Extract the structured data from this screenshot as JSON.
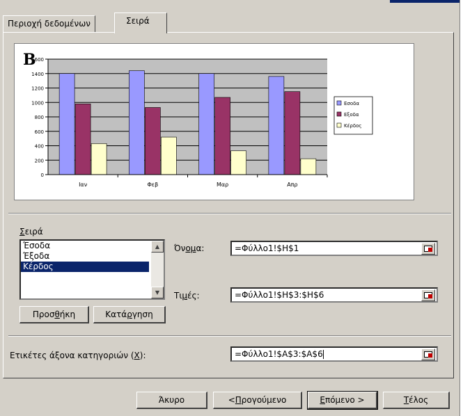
{
  "tabs": [
    "Περιοχή δεδομένων",
    "Σειρά"
  ],
  "preview_label": "B",
  "chart_data": {
    "type": "bar",
    "categories": [
      "Ιαν",
      "Φεβ",
      "Μαρ",
      "Απρ"
    ],
    "series": [
      {
        "name": "Εσοδα",
        "values": [
          1400,
          1440,
          1400,
          1360
        ],
        "color": "#9999ff"
      },
      {
        "name": "Εξοδα",
        "values": [
          980,
          930,
          1070,
          1150
        ],
        "color": "#993366"
      },
      {
        "name": "Κέρδος",
        "values": [
          430,
          520,
          330,
          220
        ],
        "color": "#ffffcc"
      }
    ],
    "yticks": [
      0,
      200,
      400,
      600,
      800,
      1000,
      1200,
      1400,
      1600
    ],
    "ylim": [
      0,
      1600
    ],
    "grid": true,
    "legend": "right",
    "plot_background": "#c0c0c0"
  },
  "series_section": {
    "title_pre": "",
    "title_u": "Σ",
    "title_post": "ειρά",
    "items": [
      "Έσοδα",
      "Έξοδα",
      "Κέρδος"
    ],
    "selected": "Κέρδος",
    "add_pre": "Προσ",
    "add_u": "θ",
    "add_post": "ήκη",
    "remove_pre": "Κατά",
    "remove_u": "ρ",
    "remove_post": "γηση"
  },
  "name_field": {
    "label_pre": "Όν",
    "label_u": "ομ",
    "label_post": "α:",
    "value": "=Φύλλο1!$H$1"
  },
  "values_field": {
    "label_pre": "Τι",
    "label_u": "μ",
    "label_post": "ές:",
    "value": "=Φύλλο1!$H$3:$H$6"
  },
  "category_field": {
    "label_pre": "Ετικέτες άξονα κατηγοριών (",
    "label_u": "Χ",
    "label_post": "):",
    "value": "=Φύλλο1!$A$3:$A$6"
  },
  "buttons": {
    "cancel": "Άκυρο",
    "back_pre": "< ",
    "back_u": "Π",
    "back_post": "ρογούμενο",
    "next_pre": "",
    "next_u": "Ε",
    "next_post": "πόμενο >",
    "finish_pre": "",
    "finish_u": "Τ",
    "finish_post": "έλος"
  }
}
